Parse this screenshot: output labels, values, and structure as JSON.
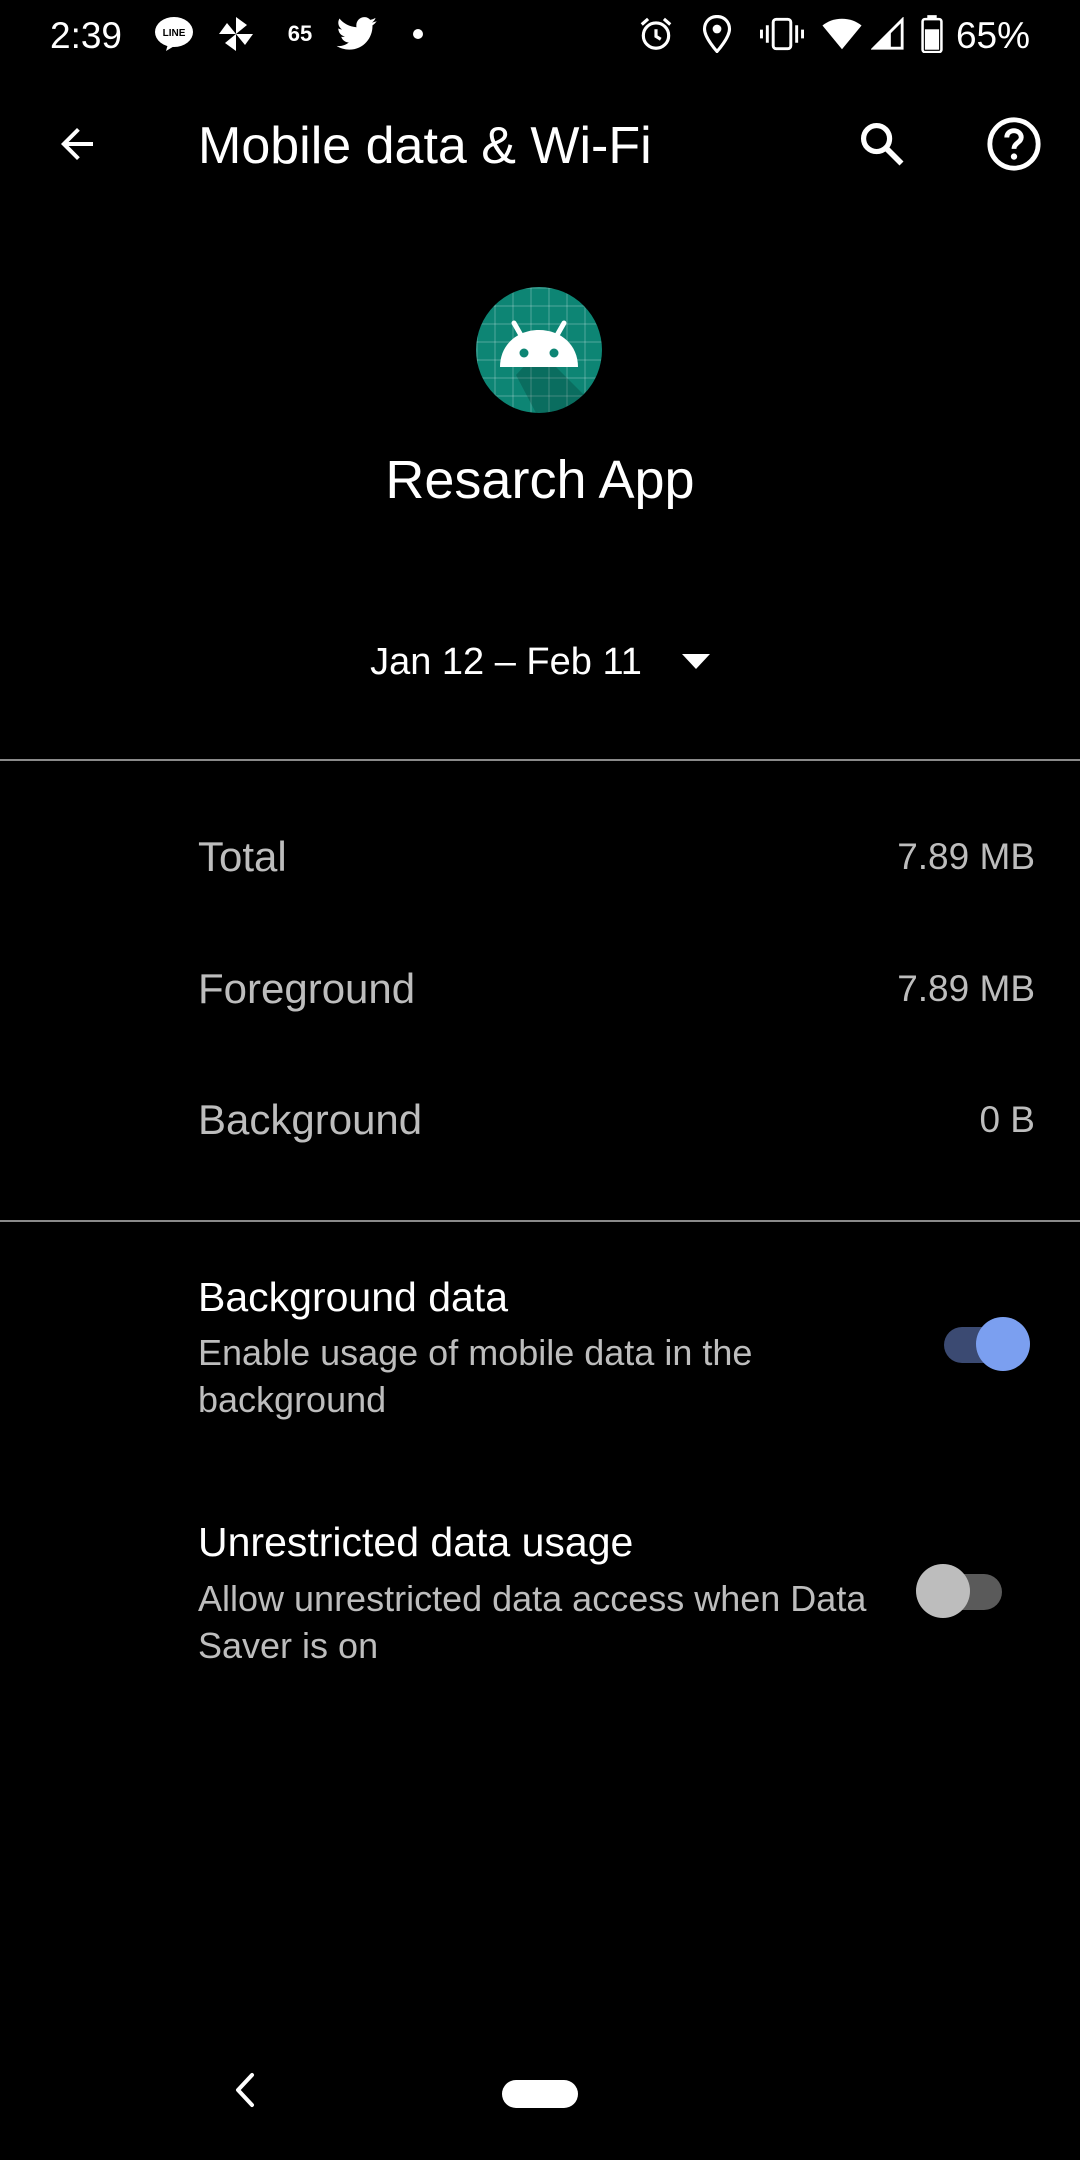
{
  "status_bar": {
    "time": "2:39",
    "notification_badge_count": "65",
    "battery_percent": "65%",
    "icons": [
      "line-icon",
      "pinwheel-icon",
      "twitter-icon",
      "dot-icon",
      "alarm-icon",
      "location-icon",
      "vibrate-icon",
      "wifi-icon",
      "signal-icon",
      "battery-icon"
    ]
  },
  "app_bar": {
    "title": "Mobile data & Wi-Fi",
    "icons": [
      "back-arrow-icon",
      "search-icon",
      "help-icon"
    ]
  },
  "app": {
    "name": "Resarch App",
    "icon": "android-icon",
    "icon_color": "#0d8574"
  },
  "date_range": {
    "selected": "Jan 12 – Feb 11",
    "icon": "dropdown-arrow-icon"
  },
  "usage": {
    "total_label": "Total",
    "total_value": "7.89 MB",
    "foreground_label": "Foreground",
    "foreground_value": "7.89 MB",
    "background_label": "Background",
    "background_value": "0 B"
  },
  "preferences": {
    "background_data": {
      "title": "Background data",
      "summary": "Enable usage of mobile data in the background",
      "enabled": true
    },
    "unrestricted_data": {
      "title": "Unrestricted data usage",
      "summary": "Allow unrestricted data access when Data Saver is on",
      "enabled": false
    }
  },
  "colors": {
    "background": "#000000",
    "accent": "#7b9ff0",
    "secondary_text": "#bdbdbd"
  },
  "nav_bar": {
    "icons": [
      "nav-back-icon",
      "home-pill-icon"
    ]
  }
}
